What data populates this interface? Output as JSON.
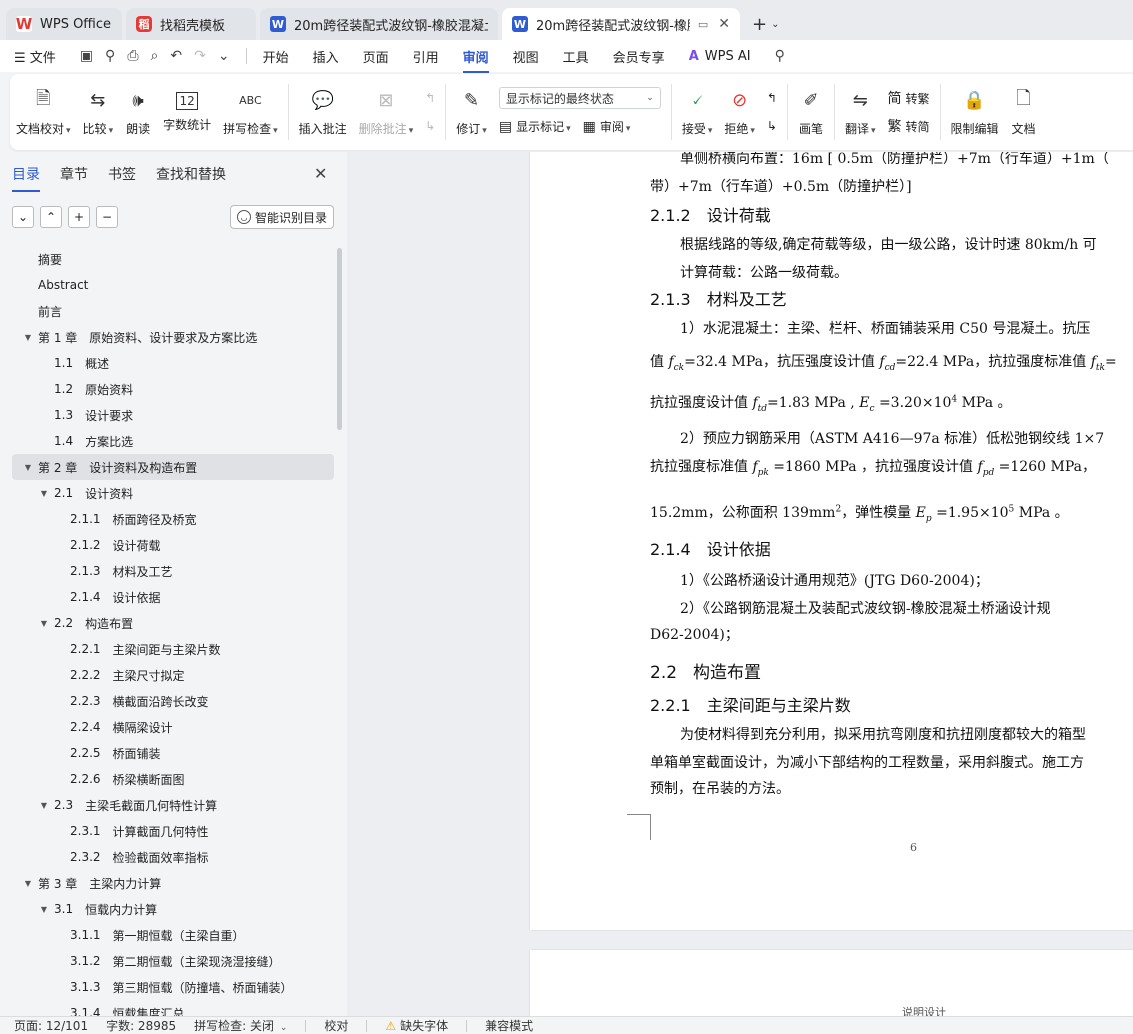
{
  "tabs": [
    {
      "label": "WPS Office",
      "icon": "wps-logo-icon"
    },
    {
      "label": "找稻壳模板",
      "icon": "daoke-icon"
    },
    {
      "label": "20m跨径装配式波纹钢-橡胶混凝土组",
      "icon": "word-doc-icon"
    },
    {
      "label": "20m跨径装配式波纹钢-橡胶混",
      "icon": "word-doc-icon"
    }
  ],
  "menu": {
    "file": "文件",
    "items": [
      "开始",
      "插入",
      "页面",
      "引用",
      "审阅",
      "视图",
      "工具",
      "会员专享"
    ],
    "active": "审阅",
    "wps_ai": "WPS AI"
  },
  "ribbon": {
    "doc_check": "文档校对",
    "compare": "比较",
    "read_aloud": "朗读",
    "word_count": "字数统计",
    "spell_check": "拼写检查",
    "insert_comment": "插入批注",
    "delete_comment": "删除批注",
    "revise": "修订",
    "markup_mode": "显示标记的最终状态",
    "show_markup": "显示标记",
    "review": "审阅",
    "accept": "接受",
    "reject": "拒绝",
    "pen": "画笔",
    "translate": "翻译",
    "to_traditional": "转繁",
    "to_simplified": "转简",
    "restrict_edit": "限制编辑",
    "doc_more": "文档"
  },
  "left_panel": {
    "tabs": [
      "目录",
      "章节",
      "书签",
      "查找和替换"
    ],
    "active_tab": "目录",
    "smart_toc": "智能识别目录",
    "toc": [
      {
        "num": "",
        "label": "摘要",
        "level": 1,
        "arrow": false
      },
      {
        "num": "",
        "label": "Abstract",
        "level": 1,
        "arrow": false
      },
      {
        "num": "",
        "label": "前言",
        "level": 1,
        "arrow": false
      },
      {
        "num": "第 1 章",
        "label": "原始资料、设计要求及方案比选",
        "level": 1,
        "arrow": true
      },
      {
        "num": "1.1",
        "label": "概述",
        "level": 2,
        "arrow": false
      },
      {
        "num": "1.2",
        "label": "原始资料",
        "level": 2,
        "arrow": false
      },
      {
        "num": "1.3",
        "label": "设计要求",
        "level": 2,
        "arrow": false
      },
      {
        "num": "1.4",
        "label": "方案比选",
        "level": 2,
        "arrow": false
      },
      {
        "num": "第 2 章",
        "label": "设计资料及构造布置",
        "level": 1,
        "arrow": true,
        "selected": true
      },
      {
        "num": "2.1",
        "label": "设计资料",
        "level": 2,
        "arrow": true
      },
      {
        "num": "2.1.1",
        "label": "桥面跨径及桥宽",
        "level": 3,
        "arrow": false
      },
      {
        "num": "2.1.2",
        "label": "设计荷载",
        "level": 3,
        "arrow": false
      },
      {
        "num": "2.1.3",
        "label": "材料及工艺",
        "level": 3,
        "arrow": false
      },
      {
        "num": "2.1.4",
        "label": "设计依据",
        "level": 3,
        "arrow": false
      },
      {
        "num": "2.2",
        "label": "构造布置",
        "level": 2,
        "arrow": true
      },
      {
        "num": "2.2.1",
        "label": "主梁间距与主梁片数",
        "level": 3,
        "arrow": false
      },
      {
        "num": "2.2.2",
        "label": "主梁尺寸拟定",
        "level": 3,
        "arrow": false
      },
      {
        "num": "2.2.3",
        "label": "横截面沿跨长改变",
        "level": 3,
        "arrow": false
      },
      {
        "num": "2.2.4",
        "label": "横隔梁设计",
        "level": 3,
        "arrow": false
      },
      {
        "num": "2.2.5",
        "label": "桥面铺装",
        "level": 3,
        "arrow": false
      },
      {
        "num": "2.2.6",
        "label": "桥梁横断面图",
        "level": 3,
        "arrow": false
      },
      {
        "num": "2.3",
        "label": "主梁毛截面几何特性计算",
        "level": 2,
        "arrow": true
      },
      {
        "num": "2.3.1",
        "label": "计算截面几何特性",
        "level": 3,
        "arrow": false
      },
      {
        "num": "2.3.2",
        "label": "检验截面效率指标",
        "level": 3,
        "arrow": false
      },
      {
        "num": "第 3 章",
        "label": "主梁内力计算",
        "level": 1,
        "arrow": true
      },
      {
        "num": "3.1",
        "label": "恒载内力计算",
        "level": 2,
        "arrow": true
      },
      {
        "num": "3.1.1",
        "label": "第一期恒载（主梁自重）",
        "level": 3,
        "arrow": false
      },
      {
        "num": "3.1.2",
        "label": "第二期恒载（主梁现浇湿接缝）",
        "level": 3,
        "arrow": false
      },
      {
        "num": "3.1.3",
        "label": "第三期恒载（防撞墙、桥面铺装）",
        "level": 3,
        "arrow": false
      },
      {
        "num": "3.1.4",
        "label": "恒载集度汇总",
        "level": 3,
        "arrow": false
      }
    ]
  },
  "doc": {
    "p1a": "单侧桥横向布置：16m [ 0.5m（防撞护栏）+7m（行车道）+1m（",
    "p1b": "带）+7m（行车道）+0.5m（防撞护栏）]",
    "h212_num": "2.1.2",
    "h212": "设计荷载",
    "p2a": "根据线路的等级,确定荷载等级，由一级公路，设计时速 80km/h 可",
    "p2b": "计算荷载：公路一级荷载。",
    "h213_num": "2.1.3",
    "h213": "材料及工艺",
    "p3a": "1）水泥混凝土：主梁、栏杆、桥面铺装采用 C50 号混凝土。抗压",
    "p3b_1": "值 ",
    "p3b_fck": "f",
    "p3b_fck_sub": "ck",
    "p3b_2": "=32.4 MPa，抗压强度设计值 ",
    "p3b_fcd": "f",
    "p3b_fcd_sub": "cd",
    "p3b_3": "=22.4 MPa，抗拉强度标准值 ",
    "p3b_ftk": "f",
    "p3b_ftk_sub": "tk",
    "p3b_4": "=",
    "p3c_1": "抗拉强度设计值 ",
    "p3c_ftd": "f",
    "p3c_ftd_sub": "td",
    "p3c_2": "=1.83 MPa , ",
    "p3c_ec": "E",
    "p3c_ec_sub": "c",
    "p3c_3": "  =3.20×10",
    "p3c_exp": "4",
    "p3c_4": " MPa 。",
    "p4a": "2）预应力钢筋采用（ASTM A416—97a 标准）低松弛钢绞线 1×7",
    "p4b_1": "抗拉强度标准值 ",
    "p4b_fpk": "f",
    "p4b_fpk_sub": "pk",
    "p4b_2": " =1860 MPa ，抗拉强度设计值 ",
    "p4b_fpd": "f",
    "p4b_fpd_sub": "pd",
    "p4b_3": " =1260 MPa，",
    "p4c_1": "15.2mm，公称面积 139mm",
    "p4c_exp": "2",
    "p4c_2": "，弹性模量 ",
    "p4c_ep": "E",
    "p4c_ep_sub": "p",
    "p4c_3": " =1.95×10",
    "p4c_exp2": "5",
    "p4c_4": " MPa 。",
    "h214_num": "2.1.4",
    "h214": "设计依据",
    "p5a": "1）《公路桥涵设计通用规范》(JTG D60-2004)；",
    "p5b": "2）《公路钢筋混凝土及装配式波纹钢-橡胶混凝土桥涵设计规",
    "p5c": "D62-2004)；",
    "h22_num": "2.2",
    "h22": "构造布置",
    "h221_num": "2.2.1",
    "h221": "主梁间距与主梁片数",
    "p6a": "为使材料得到充分利用，拟采用抗弯刚度和抗扭刚度都较大的箱型",
    "p6b": "单箱单室截面设计，为减小下部结构的工程数量，采用斜腹式。施工方",
    "p6c": "预制，在吊装的方法。",
    "page_number": "6",
    "page2_fragment": "说明设计"
  },
  "status": {
    "page": "页面: 12/101",
    "words": "字数: 28985",
    "spell": "拼写检查: 关闭",
    "proof": "校对",
    "missing_font": "缺失字体",
    "compat": "兼容模式"
  },
  "colors": {
    "accent": "#2f5bd3",
    "wps_red": "#e53935",
    "ai_purple": "#7a4cf0"
  }
}
